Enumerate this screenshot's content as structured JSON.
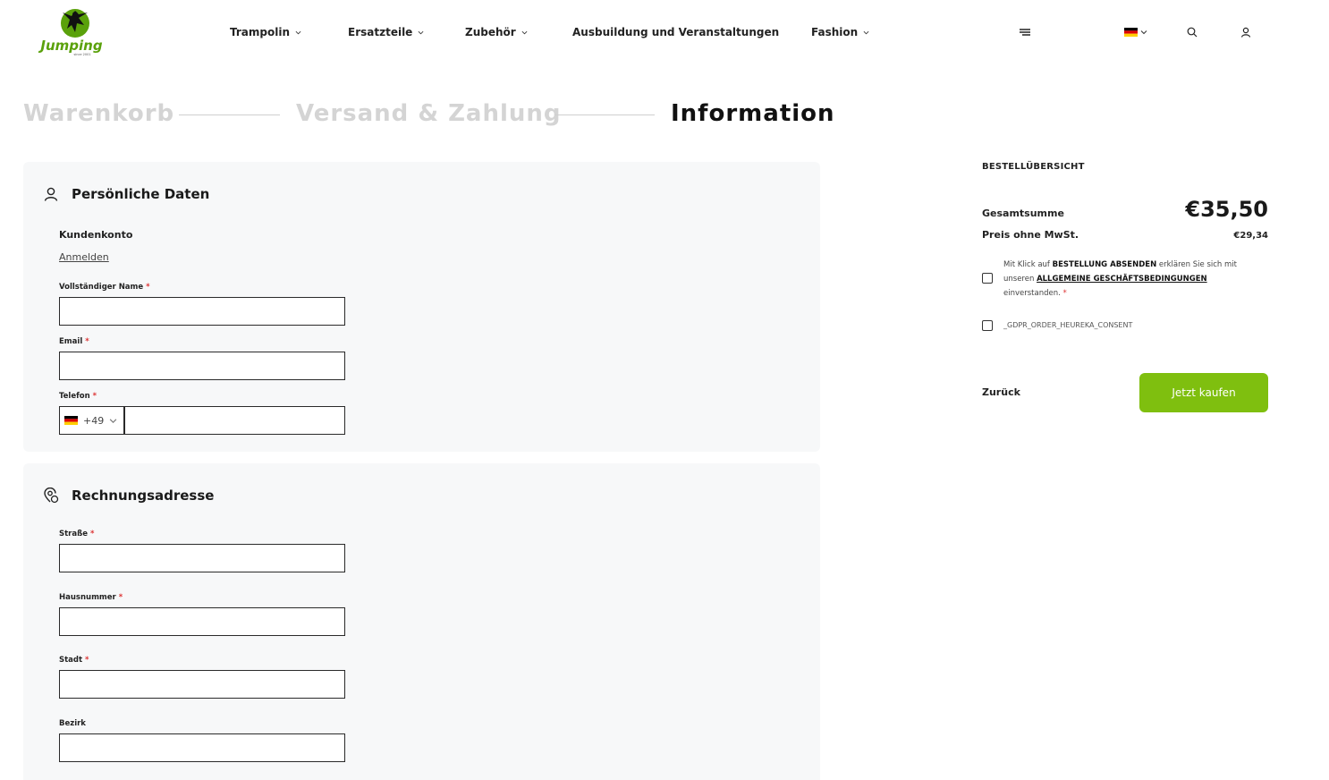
{
  "brand": {
    "logo_text": "Jumping",
    "logo_sub": "since 2001",
    "accent": "#7fbf0f"
  },
  "nav": {
    "items": [
      {
        "label": "Trampolin",
        "has_dropdown": true
      },
      {
        "label": "Ersatzteile",
        "has_dropdown": true
      },
      {
        "label": "Zubehör",
        "has_dropdown": true
      },
      {
        "label": "Ausbuildung und Veranstaltungen",
        "has_dropdown": false
      },
      {
        "label": "Fashion",
        "has_dropdown": true
      }
    ],
    "icons": [
      "menu-icon",
      "language-flag-de-icon",
      "search-icon",
      "user-icon"
    ]
  },
  "steps": [
    {
      "label": "Warenkorb",
      "active": false
    },
    {
      "label": "Versand & Zahlung",
      "active": false
    },
    {
      "label": "Information",
      "active": true
    }
  ],
  "personal": {
    "title": "Persönliche Daten",
    "account_label": "Kundenkonto",
    "login_link": "Anmelden",
    "name_label": "Vollständiger Name",
    "email_label": "Email",
    "phone_label": "Telefon",
    "phone_code": "+49",
    "required_mark": "*"
  },
  "billing": {
    "title": "Rechnungsadresse",
    "street_label": "Straße",
    "house_label": "Hausnummer",
    "city_label": "Stadt",
    "district_label": "Bezirk",
    "required_mark": "*"
  },
  "summary": {
    "title": "BESTELLÜBERSICHT",
    "total_label": "Gesamtsumme",
    "total_value": "€35,50",
    "net_label": "Preis ohne MwSt.",
    "net_value": "€29,34",
    "terms_prefix": "Mit Klick auf",
    "terms_bold": "BESTELLUNG ABSENDEN",
    "terms_mid": "erklären Sie sich mit unseren",
    "terms_link": "ALLGEMEINE GESCHÄFTSBEDINGUNGEN",
    "terms_suffix": "einverstanden.",
    "terms_required": "*",
    "gdpr_label": "_GDPR_ORDER_HEUREKA_CONSENT",
    "back_label": "Zurück",
    "buy_label": "Jetzt kaufen"
  }
}
